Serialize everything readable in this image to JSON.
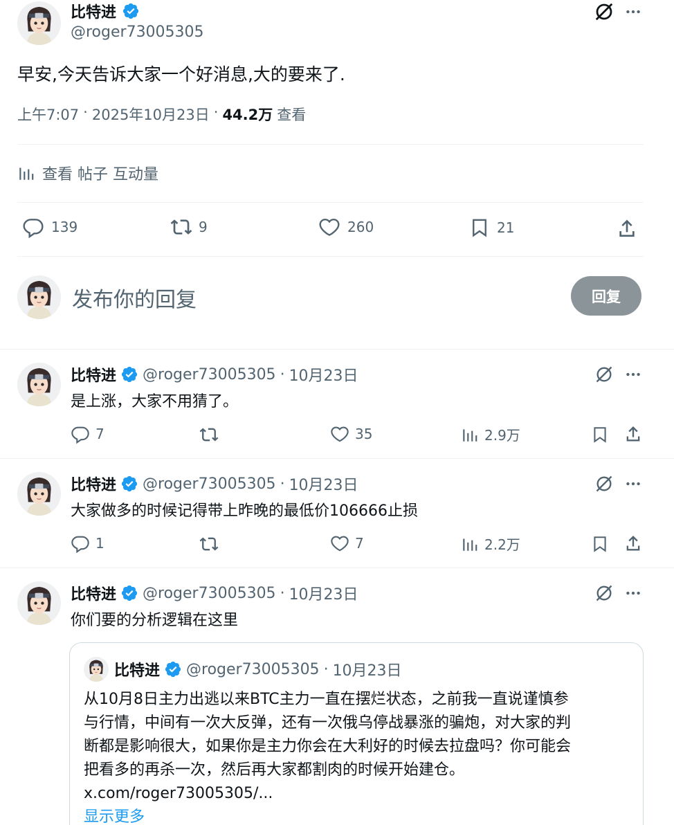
{
  "main_post": {
    "name": "比特进",
    "handle": "@roger73005305",
    "text": "早安,今天告诉大家一个好消息,大的要来了.",
    "time": "上午7:07",
    "date": "2025年10月23日",
    "views_count": "44.2万",
    "views_label": "查看",
    "sep": "·",
    "analytics_label": "查看 帖子 互动量",
    "replies": "139",
    "reposts": "9",
    "likes": "260",
    "bookmarks": "21"
  },
  "composer": {
    "placeholder": "发布你的回复",
    "button": "回复"
  },
  "replies": [
    {
      "name": "比特进",
      "handle": "@roger73005305",
      "date": "10月23日",
      "text": "是上涨，大家不用猜了。",
      "replies": "7",
      "reposts": "",
      "likes": "35",
      "views": "2.9万"
    },
    {
      "name": "比特进",
      "handle": "@roger73005305",
      "date": "10月23日",
      "text": "大家做多的时候记得带上昨晚的最低价106666止损",
      "replies": "1",
      "reposts": "",
      "likes": "7",
      "views": "2.2万"
    },
    {
      "name": "比特进",
      "handle": "@roger73005305",
      "date": "10月23日",
      "text": "你们要的分析逻辑在这里"
    }
  ],
  "quote": {
    "name": "比特进",
    "handle": "@roger73005305",
    "date": "10月23日",
    "lines": [
      "从10月8日主力出逃以来BTC主力一直在摆烂状态，之前我一直说谨慎参",
      "与行情，中间有一次大反弹，还有一次俄乌停战暴涨的骗炮，对大家的判",
      "断都是影响很大，如果你是主力你会在大利好的时候去拉盘吗？你可能会",
      "把看多的再杀一次，然后再大家都割肉的时候开始建仓。"
    ],
    "link": "x.com/roger73005305/...",
    "show_more": "显示更多"
  },
  "colors": {
    "text": "#0f1419",
    "secondary": "#536471",
    "divider": "#eff3f4",
    "verified": "#1d9bf0",
    "link": "#1d9bf0",
    "reply_button": "#8b9499"
  },
  "icons": [
    "verified-badge-icon",
    "grok-icon",
    "more-icon",
    "analytics-icon",
    "reply-icon",
    "repost-icon",
    "like-icon",
    "bookmark-icon",
    "share-icon"
  ]
}
